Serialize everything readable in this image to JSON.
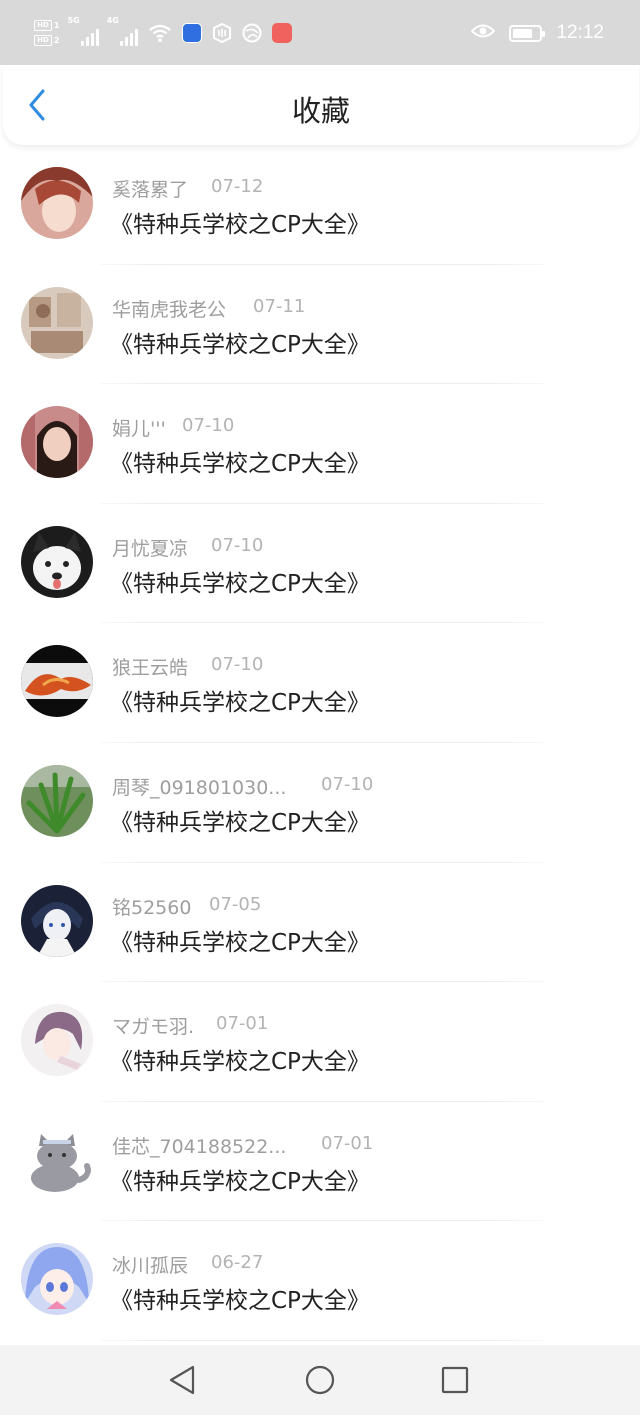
{
  "status_bar": {
    "sim1_label": "HD",
    "sim1_index": "1",
    "sim2_label": "HD",
    "sim2_index": "2",
    "sim1_network": "5G",
    "sim2_network": "4G",
    "time": "12:12",
    "icons": [
      "signal-icon",
      "signal-icon",
      "wifi-icon",
      "app-notification-icon",
      "app-notification-icon",
      "app-notification-icon",
      "app-notification-icon",
      "eye-comfort-icon",
      "battery-icon"
    ]
  },
  "header": {
    "title": "收藏",
    "back_icon": "chevron-left-icon",
    "accent_color": "#2e8bdf"
  },
  "favorites": [
    {
      "user": "奚落累了",
      "date": "07-12",
      "book": "《特种兵学校之CP大全》"
    },
    {
      "user": "华南虎我老公",
      "date": "07-11",
      "book": "《特种兵学校之CP大全》"
    },
    {
      "user": "娟儿'''",
      "date": "07-10",
      "book": "《特种兵学校之CP大全》"
    },
    {
      "user": "月忧夏凉",
      "date": "07-10",
      "book": "《特种兵学校之CP大全》"
    },
    {
      "user": "狼王云皓",
      "date": "07-10",
      "book": "《特种兵学校之CP大全》"
    },
    {
      "user": "周琴_091801030...",
      "date": "07-10",
      "book": "《特种兵学校之CP大全》"
    },
    {
      "user": "铭52560",
      "date": "07-05",
      "book": "《特种兵学校之CP大全》"
    },
    {
      "user": "マガモ羽.",
      "date": "07-01",
      "book": "《特种兵学校之CP大全》"
    },
    {
      "user": "佳芯_704188522...",
      "date": "07-01",
      "book": "《特种兵学校之CP大全》"
    },
    {
      "user": "冰川孤辰",
      "date": "06-27",
      "book": "《特种兵学校之CP大全》"
    }
  ],
  "nav_bar": {
    "back_icon": "triangle-back-icon",
    "home_icon": "circle-home-icon",
    "recents_icon": "square-recents-icon"
  }
}
